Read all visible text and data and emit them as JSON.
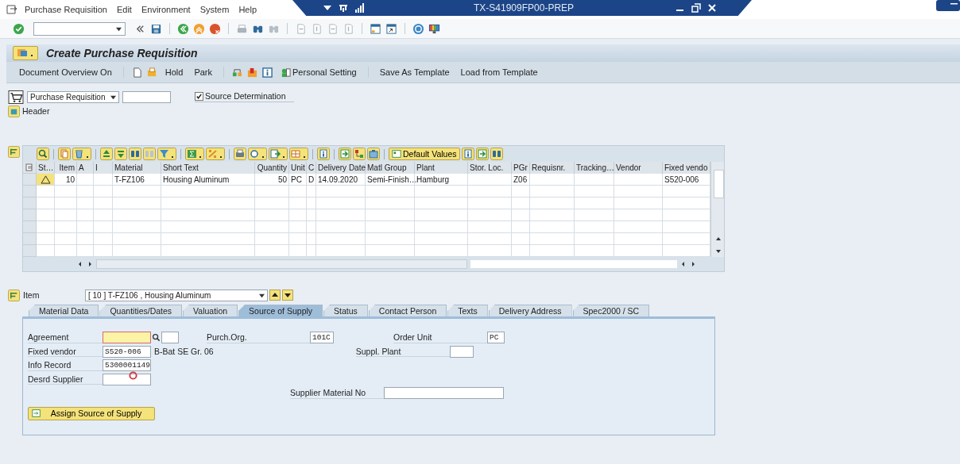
{
  "menu_bar": {
    "items": [
      "Purchase Requisition",
      "Edit",
      "Environment",
      "System",
      "Help"
    ]
  },
  "session": {
    "title": "TX-S41909FP00-PREP"
  },
  "page_title": "Create Purchase Requisition",
  "app_toolbar": [
    {
      "kind": "text",
      "label": "Document Overview On"
    },
    {
      "kind": "icon"
    },
    {
      "kind": "icon"
    },
    {
      "kind": "text",
      "label": "Hold"
    },
    {
      "kind": "text",
      "label": "Park"
    },
    {
      "kind": "icon"
    },
    {
      "kind": "icon"
    },
    {
      "kind": "icon"
    },
    {
      "kind": "text",
      "label": "Personal Setting"
    },
    {
      "kind": "text",
      "label": "Save As Template"
    },
    {
      "kind": "text",
      "label": "Load from Template"
    }
  ],
  "document": {
    "type": "Purchase Requisition",
    "source_determination": {
      "label": "Source Determination",
      "checked": true
    },
    "header_label": "Header"
  },
  "table": {
    "default_values_button": "Default Values",
    "columns": [
      "St…",
      "Item",
      "A",
      "I",
      "Material",
      "Short Text",
      "Quantity",
      "Unit",
      "C",
      "Delivery Date",
      "Matl Group",
      "Plant",
      "Stor. Loc.",
      "PGr",
      "Requisnr.",
      "Tracking…",
      "Vendor",
      "Fixed vendo"
    ],
    "rows": [
      {
        "warning": true,
        "cells": [
          "",
          "10",
          "",
          "",
          "T-FZ106",
          "Housing Aluminum",
          "50",
          "PC",
          "D",
          "14.09.2020",
          "Semi-Finish…",
          "Hamburg",
          "",
          "Z06",
          "",
          "",
          "",
          "S520-006"
        ]
      }
    ]
  },
  "item_selector": {
    "label": "Item",
    "value": "[ 10 ] T-FZ106 , Housing Aluminum"
  },
  "tabs": [
    {
      "label": "Material Data",
      "selected": false
    },
    {
      "label": "Quantities/Dates",
      "selected": false
    },
    {
      "label": "Valuation",
      "selected": false
    },
    {
      "label": "Source of Supply",
      "selected": true
    },
    {
      "label": "Status",
      "selected": false
    },
    {
      "label": "Contact Person",
      "selected": false
    },
    {
      "label": "Texts",
      "selected": false
    },
    {
      "label": "Delivery Address",
      "selected": false
    },
    {
      "label": "Spec2000 / SC",
      "selected": false
    }
  ],
  "source_of_supply": {
    "agreement": {
      "label": "Agreement",
      "required": true
    },
    "purch_org": {
      "label": "Purch.Org.",
      "value": "101C"
    },
    "order_unit": {
      "label": "Order Unit",
      "value": "PC"
    },
    "fixed_vendor": {
      "label": "Fixed vendor",
      "value": "S520-006",
      "description": "B-Bat SE Gr. 06"
    },
    "suppl_plant": {
      "label": "Suppl. Plant"
    },
    "info_record": {
      "label": "Info Record",
      "value": "5300001149"
    },
    "desrd_supplier": {
      "label": "Desrd Supplier"
    },
    "supplier_material_no": {
      "label": "Supplier Material No"
    },
    "assign_button": "Assign Source of Supply"
  }
}
